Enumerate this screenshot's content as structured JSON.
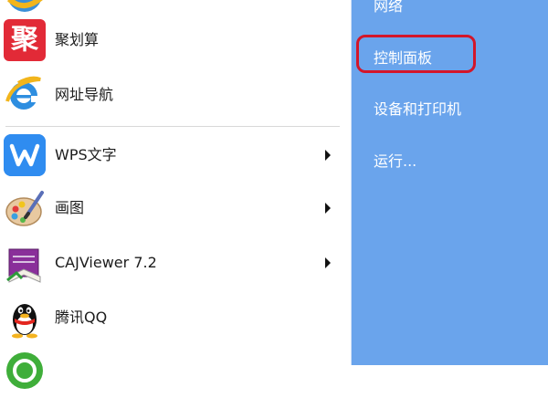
{
  "left_menu": {
    "items": [
      {
        "label": "",
        "icon": "ie-icon-partial"
      },
      {
        "label": "聚划算",
        "icon": "juhuasuan-icon",
        "icon_char": "聚"
      },
      {
        "label": "网址导航",
        "icon": "ie-icon"
      },
      {
        "label": "WPS文字",
        "icon": "wps-icon",
        "has_submenu": true
      },
      {
        "label": "画图",
        "icon": "paint-palette-icon",
        "has_submenu": true
      },
      {
        "label": "CAJViewer 7.2",
        "icon": "cajviewer-icon",
        "has_submenu": true
      },
      {
        "label": "腾讯QQ",
        "icon": "qq-penguin-icon"
      },
      {
        "label": "",
        "icon": "360-browser-icon-partial"
      }
    ]
  },
  "right_pane": {
    "items": [
      {
        "label": "网络"
      },
      {
        "label": "控制面板",
        "highlighted": true
      },
      {
        "label": "设备和打印机"
      },
      {
        "label": "运行..."
      }
    ]
  },
  "colors": {
    "right_pane_bg": "#6aa4ec",
    "highlight_border": "#d3162a",
    "left_bg": "#ffffff"
  }
}
